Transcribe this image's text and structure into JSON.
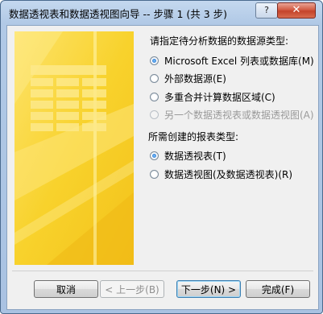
{
  "window": {
    "title": "数据透视表和数据透视图向导 -- 步骤 1 (共 3 步)",
    "help_label": "?",
    "close_label": "✕"
  },
  "data_source": {
    "heading": "请指定待分析数据的数据源类型:",
    "options": [
      {
        "label": "Microsoft Excel 列表或数据库(M)",
        "selected": true,
        "disabled": false
      },
      {
        "label": "外部数据源(E)",
        "selected": false,
        "disabled": false
      },
      {
        "label": "多重合并计算数据区域(C)",
        "selected": false,
        "disabled": false
      },
      {
        "label": "另一个数据透视表或数据透视图(A)",
        "selected": false,
        "disabled": true
      }
    ]
  },
  "report_type": {
    "heading": "所需创建的报表类型:",
    "options": [
      {
        "label": "数据透视表(T)",
        "selected": true,
        "disabled": false
      },
      {
        "label": "数据透视图(及数据透视表)(R)",
        "selected": false,
        "disabled": false
      }
    ]
  },
  "buttons": {
    "cancel": "取消",
    "back": "< 上一步(B)",
    "next": "下一步(N) >",
    "finish": "完成(F)"
  },
  "colors": {
    "art_yellow": "#f7d12a",
    "art_light": "#fbe36a",
    "accent_blue": "#1b61c4"
  }
}
